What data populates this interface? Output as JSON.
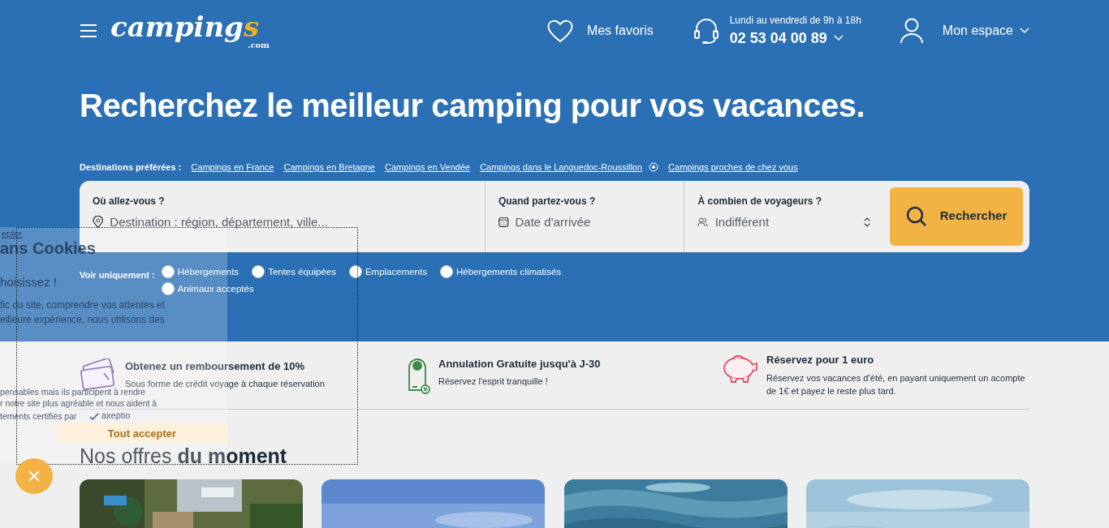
{
  "header": {
    "logo": {
      "word": "camping",
      "accent": "s",
      "suffix": ".com"
    },
    "favorites": "Mes favoris",
    "phone": {
      "hours": "Lundi au vendredi de 9h à 18h",
      "number": "02 53 04 00 89"
    },
    "account": "Mon espace"
  },
  "hero": {
    "title": "Recherchez le meilleur camping pour vos vacances.",
    "destinations_label": "Destinations préférées :",
    "destinations": [
      {
        "label": "Campings en France",
        "kind": "link"
      },
      {
        "label": "Campings en Bretagne",
        "kind": "link"
      },
      {
        "label": "Campings en Vendée",
        "kind": "link"
      },
      {
        "label": "Campings dans le Languedoc-Roussillon",
        "kind": "link"
      },
      {
        "label": "Campings proches de chez vous",
        "kind": "nearby"
      }
    ],
    "search": {
      "fields": [
        {
          "label": "Où allez-vous ?",
          "placeholder": "Destination : région, département, ville...",
          "kind": "place"
        },
        {
          "label": "Quand partez-vous ?",
          "placeholder": "Date d'arrivée",
          "kind": "date"
        },
        {
          "label": "À combien de voyageurs ?",
          "value": "Indifférent",
          "kind": "guests"
        }
      ],
      "button": "Rechercher"
    },
    "filters_label": "Voir uniquement :",
    "filters": [
      {
        "label": "Hébergements",
        "selected": false
      },
      {
        "label": "Tentes équipées",
        "selected": false
      },
      {
        "label": "Emplacements",
        "selected": false
      },
      {
        "label": "Hébergements climatisés",
        "selected": false
      },
      {
        "label": "Animaux acceptés",
        "selected": false
      }
    ]
  },
  "features": [
    {
      "kind": "tickets",
      "title": "Obtenez un remboursement de 10%",
      "text": "Sous forme de crédit voyage à chaque réservation"
    },
    {
      "kind": "doorhanger",
      "title": "Annulation Gratuite jusqu'à J-30",
      "text": "Réservez l'esprit tranquille !"
    },
    {
      "kind": "piggy",
      "title": "Réservez pour 1 euro",
      "text": "Réservez vos vacances d’été, en payant uniquement un acompte de 1€ et payez le reste plus tard."
    }
  ],
  "offers": {
    "title": "Nos offres **du moment**"
  },
  "cookie_panel": {
    "link": "epter",
    "title": "ans Cookies",
    "subtitle": "hoisissez !",
    "lines": [
      "fic du site, comprendre vos attentes et",
      "eilleure expérience, nous utilisons des",
      "pensables mais ils participent à rendre",
      "r notre site plus agréable et nous aident à"
    ],
    "certified": "tements certifiés par",
    "brand": "axeptio",
    "button": "Tout accepter"
  }
}
